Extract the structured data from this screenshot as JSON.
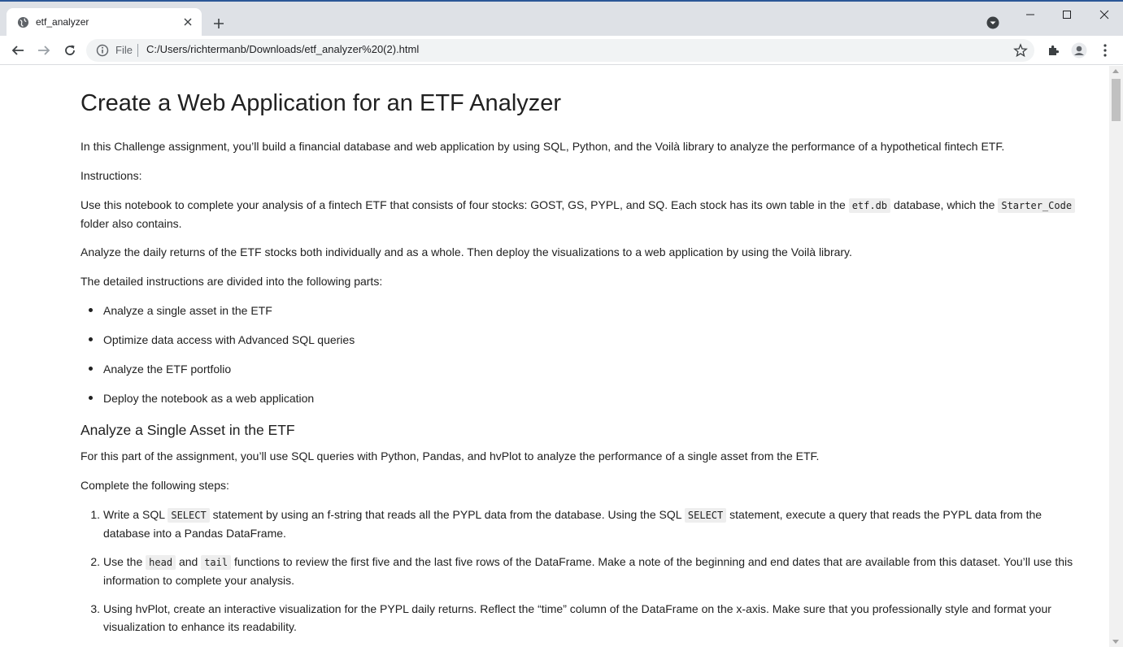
{
  "browser": {
    "tab_title": "etf_analyzer",
    "omnibox_scheme": "File",
    "url": "C:/Users/richtermanb/Downloads/etf_analyzer%20(2).html"
  },
  "doc": {
    "title": "Create a Web Application for an ETF Analyzer",
    "intro": "In this Challenge assignment, you’ll build a financial database and web application by using SQL, Python, and the Voilà library to analyze the performance of a hypothetical fintech ETF.",
    "instructions_label": "Instructions:",
    "use_notebook_pre": "Use this notebook to complete your analysis of a fintech ETF that consists of four stocks: GOST, GS, PYPL, and SQ. Each stock has its own table in the",
    "etf_db": "etf.db",
    "use_notebook_mid": "database, which the",
    "starter_code": "Starter_Code",
    "use_notebook_post": "folder also contains.",
    "analyze_daily": "Analyze the daily returns of the ETF stocks both individually and as a whole. Then deploy the visualizations to a web application by using the Voilà library.",
    "parts_intro": "The detailed instructions are divided into the following parts:",
    "parts": [
      "Analyze a single asset in the ETF",
      "Optimize data access with Advanced SQL queries",
      "Analyze the ETF portfolio",
      "Deploy the notebook as a web application"
    ],
    "section1_title": "Analyze a Single Asset in the ETF",
    "section1_intro": "For this part of the assignment, you’ll use SQL queries with Python, Pandas, and hvPlot to analyze the performance of a single asset from the ETF.",
    "steps_intro": "Complete the following steps:",
    "step1_a": "Write a SQL",
    "step1_code1": "SELECT",
    "step1_b": "statement by using an f-string that reads all the PYPL data from the database. Using the SQL",
    "step1_code2": "SELECT",
    "step1_c": "statement, execute a query that reads the PYPL data from the database into a Pandas DataFrame.",
    "step2_a": "Use the",
    "step2_code1": "head",
    "step2_b": "and",
    "step2_code2": "tail",
    "step2_c": "functions to review the first five and the last five rows of the DataFrame. Make a note of the beginning and end dates that are available from this dataset. You’ll use this information to complete your analysis.",
    "step3": "Using hvPlot, create an interactive visualization for the PYPL daily returns. Reflect the “time” column of the DataFrame on the x-axis. Make sure that you professionally style and format your visualization to enhance its readability."
  }
}
